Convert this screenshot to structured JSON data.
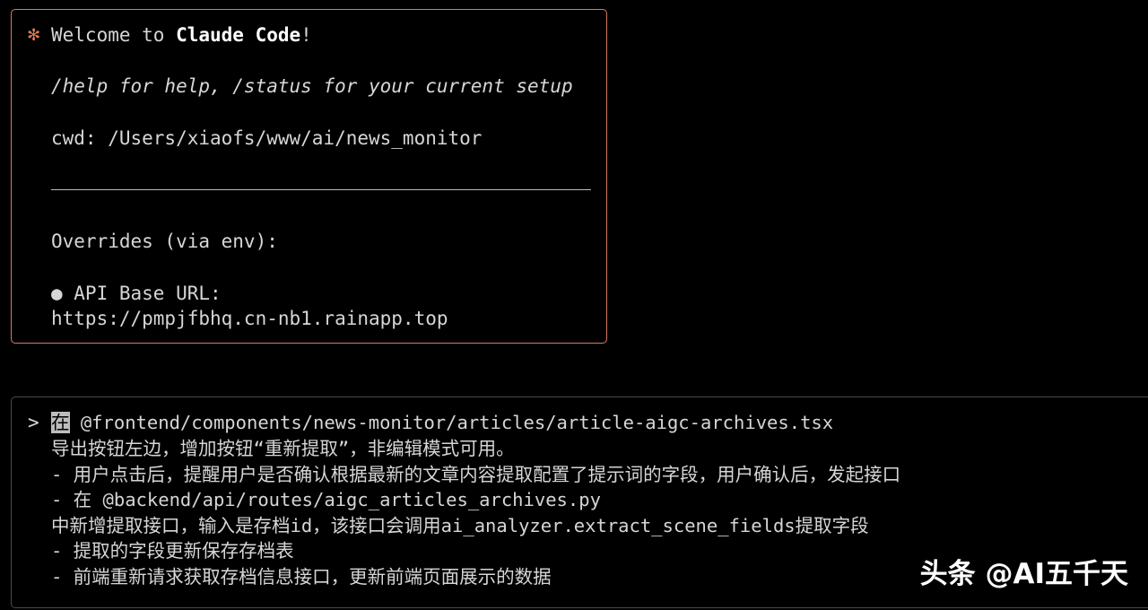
{
  "welcome": {
    "asterisk": "✻",
    "title_prefix": "Welcome to ",
    "title_brand": "Claude Code",
    "title_suffix": "!",
    "help_text": "/help for help, /status for your current setup",
    "cwd": "cwd: /Users/xiaofs/www/ai/news_monitor",
    "overrides_heading": "Overrides (via env):",
    "api_base_label": "● API Base URL:",
    "api_base_url": "https://pmpjfbhq.cn-nb1.rainapp.top"
  },
  "prompt": {
    "caret": ">",
    "cursor_char": "在",
    "lines": [
      " @frontend/components/news-monitor/articles/article-aigc-archives.tsx",
      "导出按钮左边，增加按钮“重新提取”，非编辑模式可用。",
      "- 用户点击后，提醒用户是否确认根据最新的文章内容提取配置了提示词的字段，用户确认后，发起接口",
      "- 在 @backend/api/routes/aigc_articles_archives.py",
      "中新增提取接口，输入是存档id，该接口会调用ai_analyzer.extract_scene_fields提取字段",
      "- 提取的字段更新保存存档表",
      "- 前端重新请求获取存档信息接口，更新前端页面展示的数据"
    ]
  },
  "watermark": "头条 @AI五千天",
  "colors": {
    "background": "#000000",
    "welcome_border": "#d87a5c",
    "asterisk": "#e07a55",
    "prompt_border": "#4a4a4a",
    "text": "#d6d6d6"
  }
}
